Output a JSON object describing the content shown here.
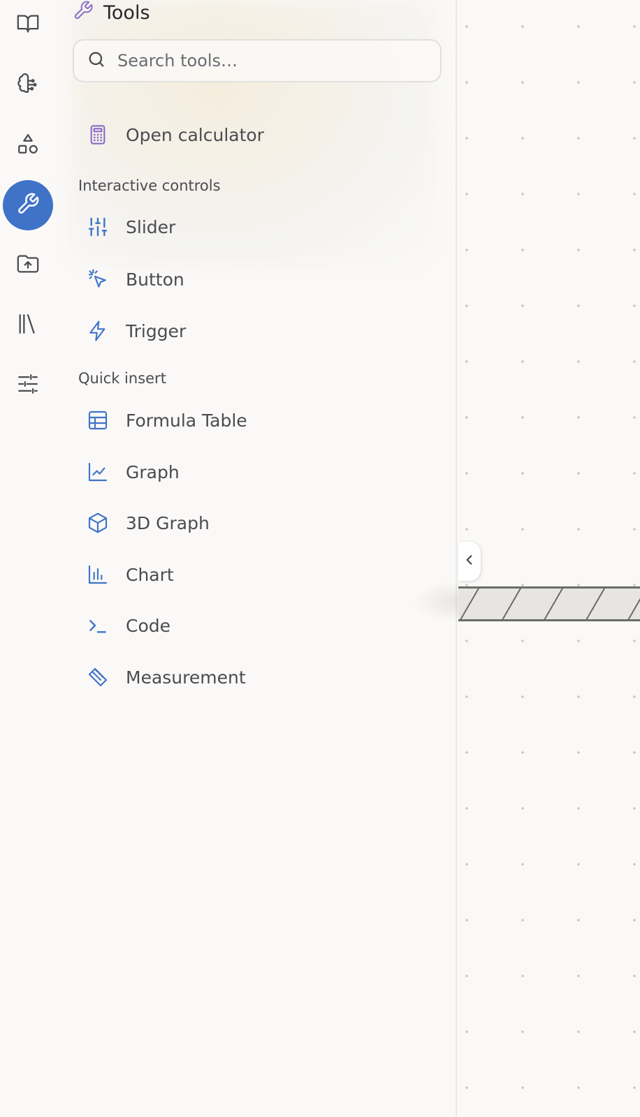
{
  "panel": {
    "title": "Tools",
    "search_placeholder": "Search tools…"
  },
  "rail": {
    "items": [
      {
        "icon": "book-open-icon"
      },
      {
        "icon": "brain-icon"
      },
      {
        "icon": "shapes-icon"
      },
      {
        "icon": "wrench-icon",
        "active": true
      },
      {
        "icon": "folder-upload-icon"
      },
      {
        "icon": "library-icon"
      },
      {
        "icon": "sliders-icon"
      }
    ]
  },
  "top_item": {
    "label": "Open calculator",
    "icon": "calculator-icon"
  },
  "sections": {
    "interactive": {
      "title": "Interactive controls",
      "items": [
        {
          "label": "Slider",
          "icon": "sliders-vertical-icon"
        },
        {
          "label": "Button",
          "icon": "pointer-click-icon"
        },
        {
          "label": "Trigger",
          "icon": "zap-icon"
        }
      ]
    },
    "quick_insert": {
      "title": "Quick insert",
      "items": [
        {
          "label": "Formula Table",
          "icon": "table-icon"
        },
        {
          "label": "Graph",
          "icon": "line-chart-icon"
        },
        {
          "label": "3D Graph",
          "icon": "cube-icon"
        },
        {
          "label": "Chart",
          "icon": "bar-chart-icon"
        },
        {
          "label": "Code",
          "icon": "terminal-icon"
        },
        {
          "label": "Measurement",
          "icon": "ruler-icon"
        }
      ]
    }
  },
  "colors": {
    "accent": "#3f73c8",
    "purple": "#8a6bc6",
    "background": "#faf9f7"
  }
}
